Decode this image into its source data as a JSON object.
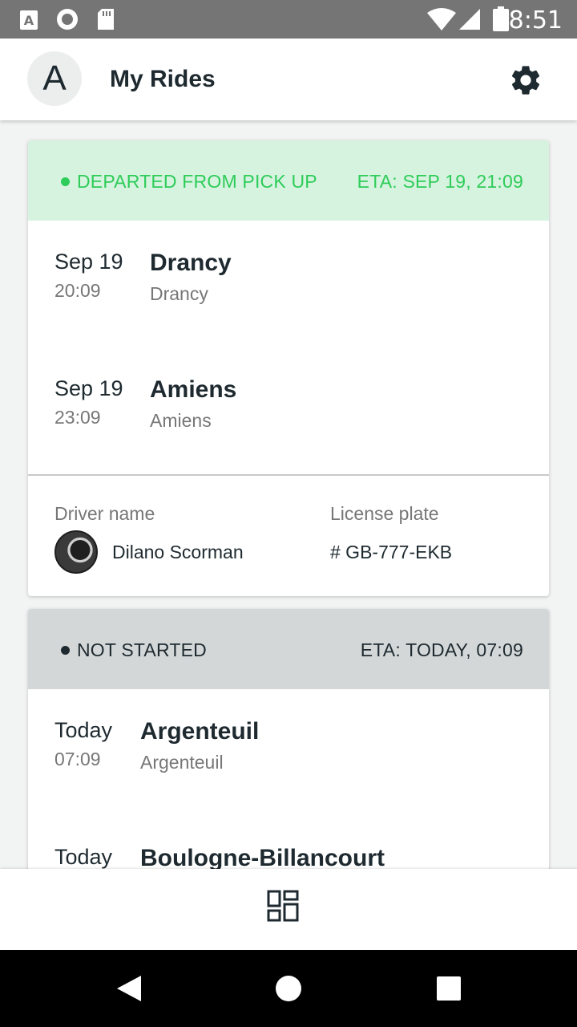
{
  "status_bar": {
    "time": "8:51",
    "icons": [
      "a-notification-icon",
      "record-icon",
      "sd-card-icon",
      "wifi-icon",
      "signal-icon",
      "battery-icon"
    ]
  },
  "header": {
    "avatar_letter": "A",
    "title": "My Rides",
    "settings_icon": "gear-icon"
  },
  "rides": [
    {
      "status": "DEPARTED FROM PICK UP",
      "eta": "ETA: SEP 19, 21:09",
      "status_color": "#2ecc58",
      "head_bg": "#d6f3e0",
      "stops": [
        {
          "date": "Sep 19",
          "time": "20:09",
          "city": "Drancy",
          "sub": "Drancy"
        },
        {
          "date": "Sep 19",
          "time": "23:09",
          "city": "Amiens",
          "sub": "Amiens"
        }
      ],
      "driver_label": "Driver name",
      "driver_name": "Dilano Scorman",
      "plate_label": "License plate",
      "plate": "# GB-777-EKB"
    },
    {
      "status": "NOT STARTED",
      "eta": "ETA: TODAY, 07:09",
      "status_color": "#1e2a30",
      "head_bg": "#d4d7d8",
      "stops": [
        {
          "date": "Today",
          "time": "07:09",
          "city": "Argenteuil",
          "sub": "Argenteuil"
        },
        {
          "date": "Today",
          "time": "",
          "city": "Boulogne-Billancourt",
          "sub": ""
        }
      ]
    }
  ],
  "bottom_bar": {
    "icon": "qr-scan-icon"
  },
  "nav_bar": {
    "icons": [
      "back-icon",
      "home-icon",
      "recents-icon"
    ]
  }
}
